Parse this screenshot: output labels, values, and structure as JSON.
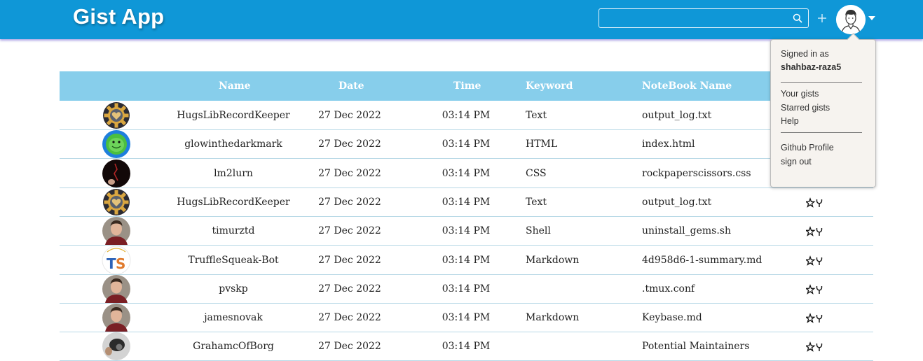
{
  "header": {
    "app_title": "Gist App",
    "search_value": "",
    "search_placeholder": "",
    "accent_color": "#0f97d7"
  },
  "dropdown": {
    "signed_in_label": "Signed in as",
    "username": "shahbaz-raza5",
    "your_gists": "Your gists",
    "starred_gists": "Starred gists",
    "help": "Help",
    "github_profile": "Github Profile",
    "sign_out": "sign out"
  },
  "table": {
    "header_color": "#87ceeb",
    "columns": [
      "Name",
      "Date",
      "Time",
      "Keyword",
      "NoteBook Name"
    ],
    "rows": [
      {
        "name": "HugsLibRecordKeeper",
        "date": "27 Dec 2022",
        "time": "03:14 PM",
        "keyword": "Text",
        "notebook": "output_log.txt",
        "avatar": "gear-heart-avatar"
      },
      {
        "name": "glowinthedarkmark",
        "date": "27 Dec 2022",
        "time": "03:14 PM",
        "keyword": "HTML",
        "notebook": "index.html",
        "avatar": "green-alien-avatar"
      },
      {
        "name": "lm2lurn",
        "date": "27 Dec 2022",
        "time": "03:14 PM",
        "keyword": "CSS",
        "notebook": "rockpaperscissors.css",
        "avatar": "dark-photo-avatar"
      },
      {
        "name": "HugsLibRecordKeeper",
        "date": "27 Dec 2022",
        "time": "03:14 PM",
        "keyword": "Text",
        "notebook": "output_log.txt",
        "avatar": "gear-heart-avatar"
      },
      {
        "name": "timurztd",
        "date": "27 Dec 2022",
        "time": "03:14 PM",
        "keyword": "Shell",
        "notebook": "uninstall_gems.sh",
        "avatar": "man-photo-avatar"
      },
      {
        "name": "TruffleSqueak-Bot",
        "date": "27 Dec 2022",
        "time": "03:14 PM",
        "keyword": "Markdown",
        "notebook": "4d958d6-1-summary.md",
        "avatar": "ts-logo-avatar"
      },
      {
        "name": "pvskp",
        "date": "27 Dec 2022",
        "time": "03:14 PM",
        "keyword": "",
        "notebook": ".tmux.conf",
        "avatar": "man-photo-avatar"
      },
      {
        "name": "jamesnovak",
        "date": "27 Dec 2022",
        "time": "03:14 PM",
        "keyword": "Markdown",
        "notebook": "Keybase.md",
        "avatar": "man-photo-avatar"
      },
      {
        "name": "GrahamcOfBorg",
        "date": "27 Dec 2022",
        "time": "03:14 PM",
        "keyword": "",
        "notebook": "Potential Maintainers",
        "avatar": "camera-photo-avatar"
      }
    ]
  }
}
